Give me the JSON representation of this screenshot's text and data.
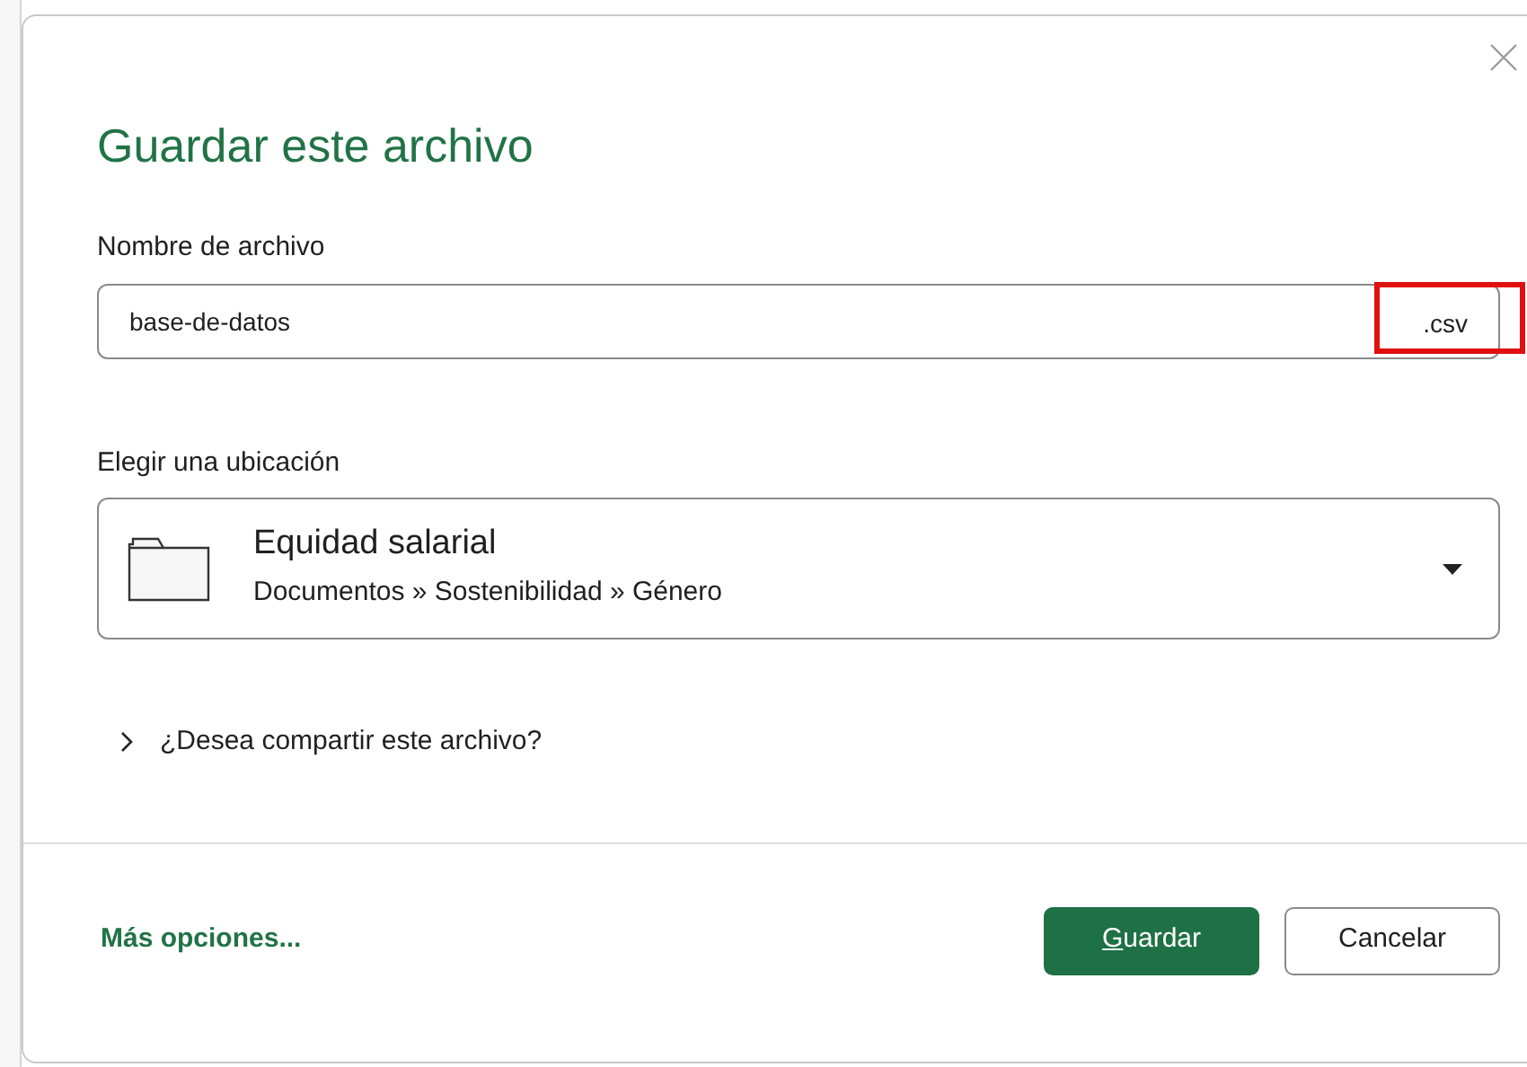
{
  "dialog": {
    "title": "Guardar este archivo",
    "file_name": {
      "label": "Nombre de archivo",
      "value": "base-de-datos",
      "extension": ".csv",
      "extension_highlighted": true
    },
    "location": {
      "label": "Elegir una ubicación",
      "name": "Equidad salarial",
      "path": "Documentos » Sostenibilidad » Género"
    },
    "share": {
      "label": "¿Desea compartir este archivo?",
      "expanded": false
    },
    "more_options": "Más opciones...",
    "buttons": [
      {
        "label": "Guardar",
        "kind": "primary"
      },
      {
        "label": "Cancelar",
        "kind": "secondary"
      }
    ]
  }
}
